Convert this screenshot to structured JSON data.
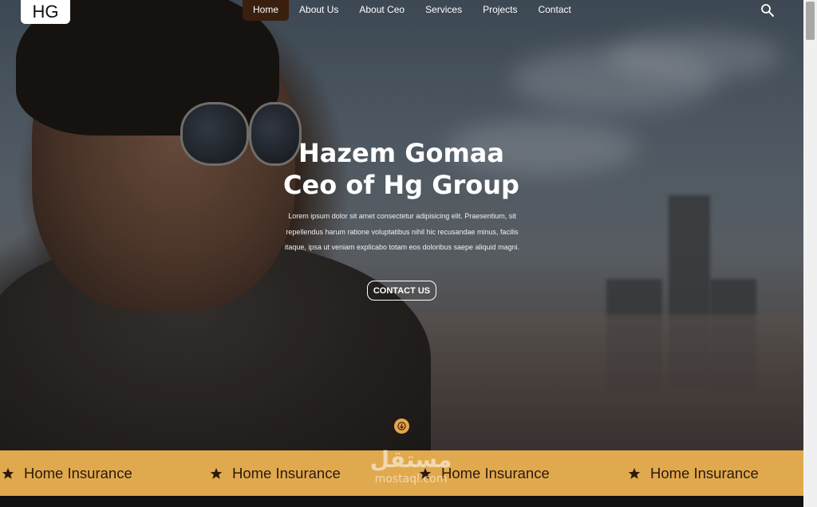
{
  "logo": {
    "text": "HG"
  },
  "nav": {
    "items": [
      {
        "label": "Home",
        "active": true
      },
      {
        "label": "About Us",
        "active": false
      },
      {
        "label": "About Ceo",
        "active": false
      },
      {
        "label": "Services",
        "active": false
      },
      {
        "label": "Projects",
        "active": false
      },
      {
        "label": "Contact",
        "active": false
      }
    ],
    "search_icon": "search-icon"
  },
  "hero": {
    "title_line1": "Hazem Gomaa",
    "title_line2": "Ceo of Hg Group",
    "description": "Lorem ipsum dolor sit amet consectetur adipisicing elit. Praesentium, sit repellendus harum ratione voluptatibus nihil hic recusandae minus, facilis itaque, ipsa ut veniam explicabo totam eos doloribus saepe aliquid magni.",
    "cta_label": "CONTACT US",
    "scroll_icon": "arrow-down-circle-icon"
  },
  "band": {
    "items": [
      {
        "icon": "star-icon",
        "label": "Home Insurance"
      },
      {
        "icon": "star-icon",
        "label": "Home Insurance"
      },
      {
        "icon": "star-icon",
        "label": "Home Insurance"
      },
      {
        "icon": "star-icon",
        "label": "Home Insurance"
      }
    ]
  },
  "watermark": {
    "arabic": "مستقل",
    "latin": "mostaql.com"
  },
  "colors": {
    "accent": "#e1a94e",
    "nav_active": "#3a1f0e",
    "band_text": "#2b1a0c"
  }
}
